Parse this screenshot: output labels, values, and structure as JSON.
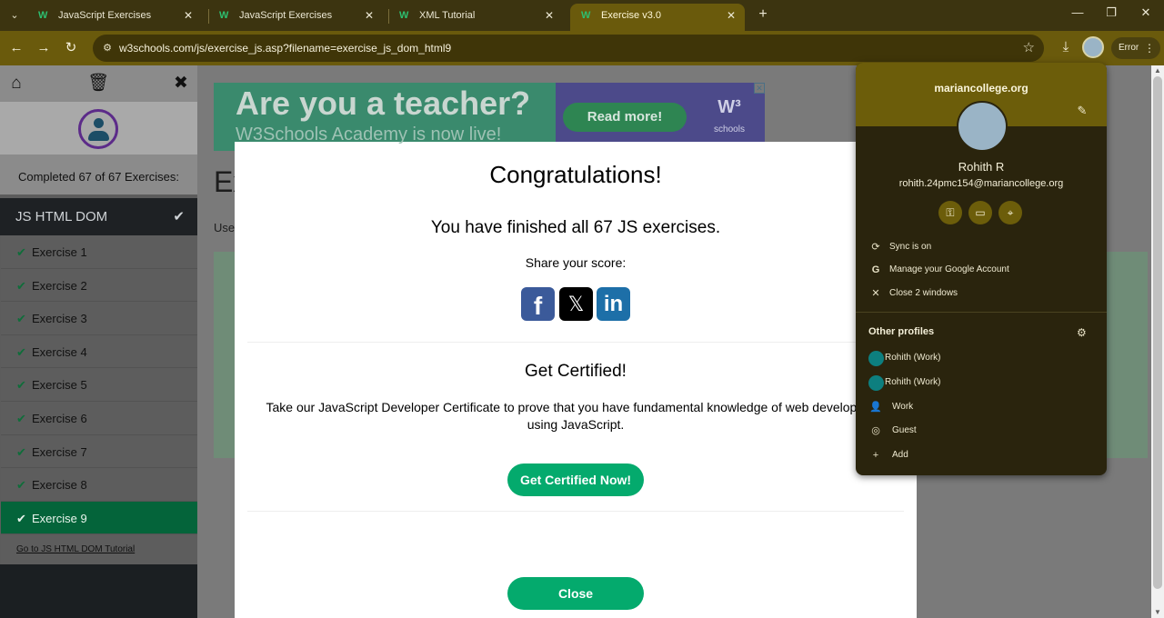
{
  "browser": {
    "tabs": [
      {
        "title": "JavaScript Exercises",
        "active": false
      },
      {
        "title": "JavaScript Exercises",
        "active": false
      },
      {
        "title": "XML Tutorial",
        "active": false
      },
      {
        "title": "Exercise v3.0",
        "active": true
      }
    ],
    "url": "w3schools.com/js/exercise_js.asp?filename=exercise_js_dom_html9",
    "error_label": "Error"
  },
  "sidebar": {
    "completed_text": "Completed 67 of 67 Exercises:",
    "section_title": "JS HTML DOM",
    "exercises": [
      "Exercise 1",
      "Exercise 2",
      "Exercise 3",
      "Exercise 4",
      "Exercise 5",
      "Exercise 6",
      "Exercise 7",
      "Exercise 8",
      "Exercise 9"
    ],
    "active_exercise": "Exercise 9",
    "tutorial_link": "Go to JS HTML DOM Tutorial"
  },
  "ad": {
    "title": "Are you a teacher?",
    "subtitle": "W3Schools Academy is now live!",
    "button": "Read more!",
    "logo_sub": "schools"
  },
  "background": {
    "heading_fragment": "Ex",
    "use_fragment": "Use"
  },
  "modal": {
    "title": "Congratulations!",
    "finished": "You have finished all 67 JS exercises.",
    "share": "Share your score:",
    "cert_title": "Get Certified!",
    "cert_desc": "Take our JavaScript Developer Certificate to prove that you have fundamental knowledge of web development using JavaScript.",
    "cert_button": "Get Certified Now!",
    "close_button": "Close"
  },
  "profile_popup": {
    "org": "mariancollege.org",
    "name": "Rohith R",
    "email": "rohith.24pmc154@mariancollege.org",
    "sync": "Sync is on",
    "manage": "Manage your Google Account",
    "close_windows": "Close 2 windows",
    "other_profiles": "Other profiles",
    "profiles": [
      "Rohith (Work)",
      "Rohith (Work)",
      "Work",
      "Guest",
      "Add"
    ]
  }
}
